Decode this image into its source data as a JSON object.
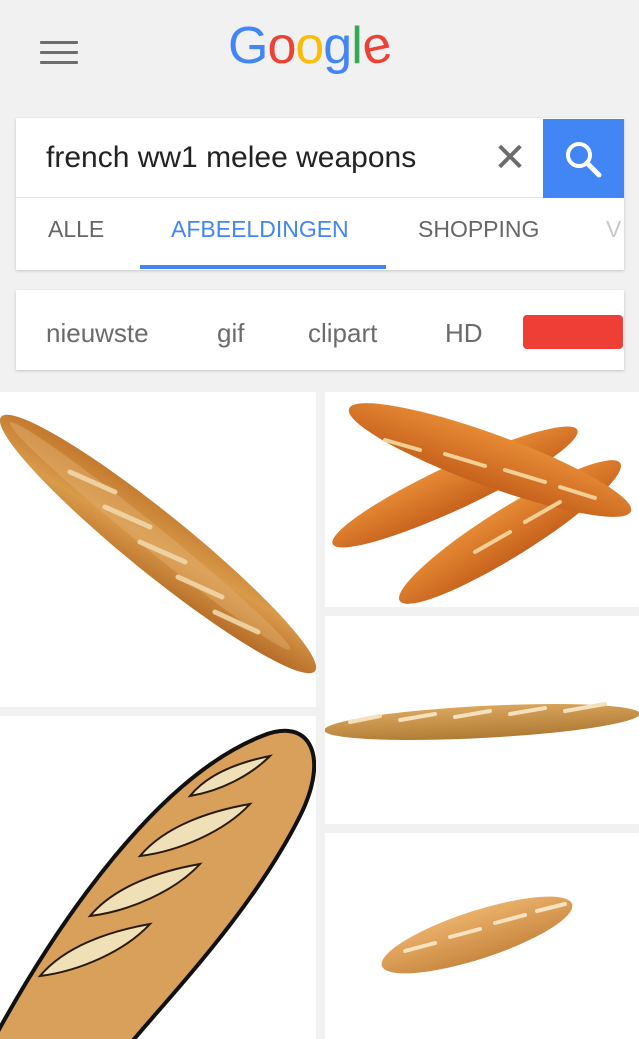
{
  "header": {
    "logo_letters": [
      {
        "char": "G",
        "color": "#4285F4"
      },
      {
        "char": "o",
        "color": "#EA4335"
      },
      {
        "char": "o",
        "color": "#FBBC05"
      },
      {
        "char": "g",
        "color": "#4285F4"
      },
      {
        "char": "l",
        "color": "#34A853"
      },
      {
        "char": "e",
        "color": "#EA4335"
      }
    ],
    "menu_icon": "hamburger-menu-icon"
  },
  "search": {
    "query": "french ww1 melee weapons",
    "clear_glyph": "✕",
    "button_icon": "magnifier-icon",
    "button_color": "#4285F4"
  },
  "tabs": [
    {
      "label": "ALLE",
      "active": false
    },
    {
      "label": "AFBEELDINGEN",
      "active": true
    },
    {
      "label": "SHOPPING",
      "active": false
    },
    {
      "label": "V",
      "active": false
    }
  ],
  "filters": {
    "chips": [
      "nieuwste",
      "gif",
      "clipart",
      "HD"
    ],
    "color_chip": "#EF3E36"
  },
  "results": {
    "images": [
      "baguette-photo",
      "three-baguettes-photo",
      "long-baguette-photo",
      "baguette-clipart",
      "short-baguette-photo"
    ]
  }
}
